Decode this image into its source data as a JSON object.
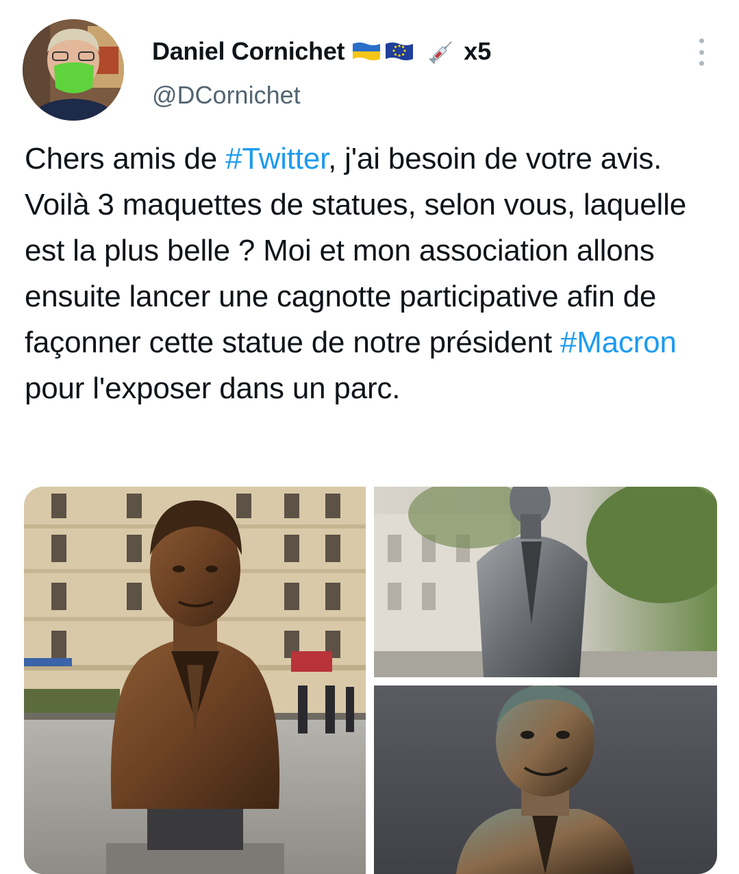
{
  "author": {
    "display_name": "Daniel Cornichet",
    "badge_count": "x5",
    "handle": "@DCornichet",
    "flag_icons": [
      "ukraine-flag-icon",
      "eu-flag-icon"
    ],
    "extra_icon": "syringe-icon"
  },
  "tweet": {
    "segments": [
      {
        "text": "Chers amis de ",
        "type": "text"
      },
      {
        "text": "#Twitter",
        "type": "hashtag"
      },
      {
        "text": ", j'ai besoin de votre avis. Voilà 3 maquettes de statues, selon vous, laquelle est la plus belle ? Moi et mon association allons ensuite lancer une cagnotte participative afin de façonner cette statue de notre président ",
        "type": "text"
      },
      {
        "text": "#Macron",
        "type": "hashtag"
      },
      {
        "text": " pour l'exposer dans un parc.",
        "type": "text"
      }
    ]
  },
  "colors": {
    "hashtag": "#1d9bf0",
    "handle": "#536471",
    "text": "#0f1419"
  },
  "media": {
    "count": 3,
    "items": [
      "bronze-bust-statue-photo",
      "grey-standing-statue-photo",
      "patina-bust-statue-photo"
    ]
  }
}
